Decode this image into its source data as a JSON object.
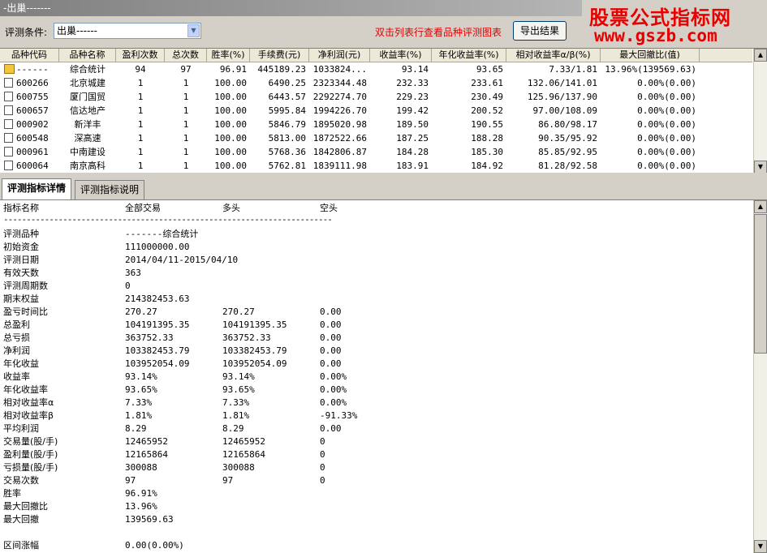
{
  "window": {
    "title": "-出巢-------"
  },
  "watermark": {
    "line1": "股票公式指标网",
    "line2": "www.gszb.com"
  },
  "controls": {
    "condition_label": "评测条件:",
    "condition_value": "出巢------",
    "hint": "双击列表行查看品种评测图表",
    "export_label": "导出结果"
  },
  "table": {
    "columns": [
      "品种代码",
      "品种名称",
      "盈利次数",
      "总次数",
      "胜率(%)",
      "手续费(元)",
      "净利润(元)",
      "收益率(%)",
      "年化收益率(%)",
      "相对收益率α/β(%)",
      "最大回撤比(值)"
    ],
    "rows": [
      {
        "icon": "folder-icon",
        "code": "------",
        "name": "综合统计",
        "win": "94",
        "total": "97",
        "rate": "96.91",
        "fee": "445189.23",
        "profit": "1033824...",
        "ret": "93.14",
        "annual": "93.65",
        "rel": "7.33/1.81",
        "dd": "13.96%(139569.63)"
      },
      {
        "icon": "doc-icon",
        "code": "600266",
        "name": "北京城建",
        "win": "1",
        "total": "1",
        "rate": "100.00",
        "fee": "6490.25",
        "profit": "2323344.48",
        "ret": "232.33",
        "annual": "233.61",
        "rel": "132.06/141.01",
        "dd": "0.00%(0.00)"
      },
      {
        "icon": "doc-icon",
        "code": "600755",
        "name": "厦门国贸",
        "win": "1",
        "total": "1",
        "rate": "100.00",
        "fee": "6443.57",
        "profit": "2292274.70",
        "ret": "229.23",
        "annual": "230.49",
        "rel": "125.96/137.90",
        "dd": "0.00%(0.00)"
      },
      {
        "icon": "doc-icon",
        "code": "600657",
        "name": "信达地产",
        "win": "1",
        "total": "1",
        "rate": "100.00",
        "fee": "5995.84",
        "profit": "1994226.70",
        "ret": "199.42",
        "annual": "200.52",
        "rel": "97.00/108.09",
        "dd": "0.00%(0.00)"
      },
      {
        "icon": "doc-icon",
        "code": "000902",
        "name": "新洋丰",
        "win": "1",
        "total": "1",
        "rate": "100.00",
        "fee": "5846.79",
        "profit": "1895020.98",
        "ret": "189.50",
        "annual": "190.55",
        "rel": "86.80/98.17",
        "dd": "0.00%(0.00)"
      },
      {
        "icon": "doc-icon",
        "code": "600548",
        "name": "深高速",
        "win": "1",
        "total": "1",
        "rate": "100.00",
        "fee": "5813.00",
        "profit": "1872522.66",
        "ret": "187.25",
        "annual": "188.28",
        "rel": "90.35/95.92",
        "dd": "0.00%(0.00)"
      },
      {
        "icon": "doc-icon",
        "code": "000961",
        "name": "中南建设",
        "win": "1",
        "total": "1",
        "rate": "100.00",
        "fee": "5768.36",
        "profit": "1842806.87",
        "ret": "184.28",
        "annual": "185.30",
        "rel": "85.85/92.95",
        "dd": "0.00%(0.00)"
      },
      {
        "icon": "doc-icon",
        "code": "600064",
        "name": "南京高科",
        "win": "1",
        "total": "1",
        "rate": "100.00",
        "fee": "5762.81",
        "profit": "1839111.98",
        "ret": "183.91",
        "annual": "184.92",
        "rel": "81.28/92.58",
        "dd": "0.00%(0.00)"
      }
    ]
  },
  "tabs": [
    "评测指标详情",
    "评测指标说明"
  ],
  "detail": {
    "header": [
      "指标名称",
      "全部交易",
      "多头",
      "空头"
    ],
    "separator": "------------------------------------------------------------------------",
    "rows": [
      [
        "评测品种",
        "-------综合统计",
        "",
        ""
      ],
      [
        "初始资金",
        "111000000.00",
        "",
        ""
      ],
      [
        "评测日期",
        "2014/04/11-2015/04/10",
        "",
        ""
      ],
      [
        "有效天数",
        "363",
        "",
        ""
      ],
      [
        "评测周期数",
        "0",
        "",
        ""
      ],
      [
        "期末权益",
        "214382453.63",
        "",
        ""
      ],
      [
        "盈亏时间比",
        "270.27",
        "270.27",
        "0.00"
      ],
      [
        "总盈利",
        "104191395.35",
        "104191395.35",
        "0.00"
      ],
      [
        "总亏损",
        "363752.33",
        "363752.33",
        "0.00"
      ],
      [
        "净利润",
        "103382453.79",
        "103382453.79",
        "0.00"
      ],
      [
        "年化收益",
        "103952054.09",
        "103952054.09",
        "0.00"
      ],
      [
        "收益率",
        "93.14%",
        "93.14%",
        "0.00%"
      ],
      [
        "年化收益率",
        "93.65%",
        "93.65%",
        "0.00%"
      ],
      [
        "相对收益率α",
        "7.33%",
        "7.33%",
        " 0.00%"
      ],
      [
        "相对收益率β",
        "1.81%",
        "1.81%",
        " -91.33%"
      ],
      [
        "平均利润",
        "8.29",
        "8.29",
        "0.00"
      ],
      [
        "交易量(股/手)",
        "12465952",
        "12465952",
        "0"
      ],
      [
        "盈利量(股/手)",
        "12165864",
        "12165864",
        "0"
      ],
      [
        "亏损量(股/手)",
        "300088",
        "300088",
        "0"
      ],
      [
        "交易次数",
        "97",
        "97",
        "0"
      ],
      [
        "胜率",
        "96.91%",
        "",
        ""
      ],
      [
        "最大回撤比",
        "13.96%",
        "",
        ""
      ],
      [
        "最大回撤",
        "139569.63",
        "",
        ""
      ],
      [
        "",
        "",
        "",
        ""
      ],
      [
        "区间涨幅",
        "0.00(0.00%)",
        "",
        ""
      ]
    ]
  },
  "colors": {
    "accent_red": "#e60000",
    "panel": "#d4d0c8"
  }
}
